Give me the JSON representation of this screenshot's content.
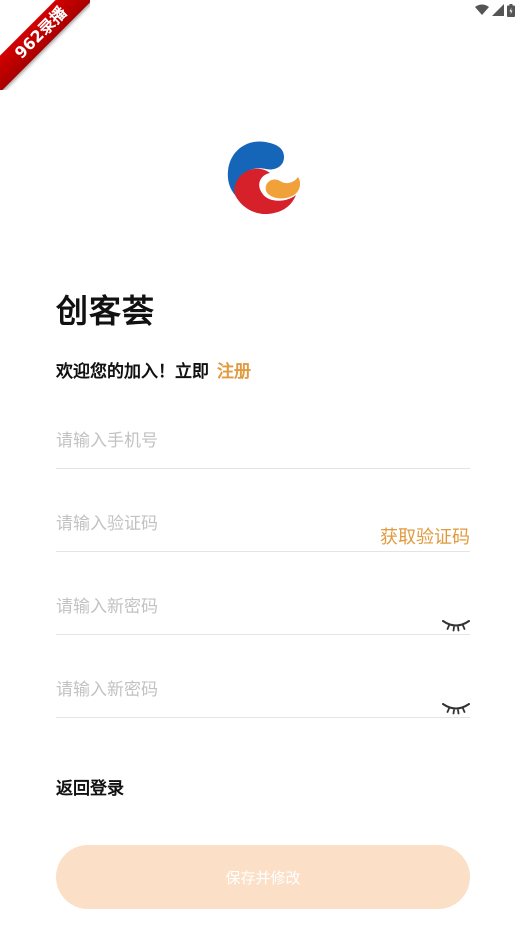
{
  "watermark": {
    "text": "962录播"
  },
  "status_bar": {
    "icons": [
      "wifi-icon",
      "signal-icon",
      "battery-icon"
    ]
  },
  "logo": {
    "icon": "brand-logo-icon",
    "colors": {
      "blue": "#1565b8",
      "red": "#d6202a",
      "orange": "#f0a13a"
    }
  },
  "header": {
    "title": "创客荟",
    "welcome_text": "欢迎您的加入！立即",
    "register_label": "注册"
  },
  "form": {
    "phone": {
      "placeholder": "请输入手机号",
      "value": ""
    },
    "code": {
      "placeholder": "请输入验证码",
      "value": "",
      "get_code_label": "获取验证码"
    },
    "new_password": {
      "placeholder": "请输入新密码",
      "value": ""
    },
    "confirm_password": {
      "placeholder": "请输入新密码",
      "value": ""
    }
  },
  "back_login_label": "返回登录",
  "submit_label": "保存并修改",
  "colors": {
    "accent": "#e19a3e",
    "button_bg": "#fbdfc6",
    "placeholder": "#c2c2c2",
    "divider": "#e4e4e4"
  }
}
